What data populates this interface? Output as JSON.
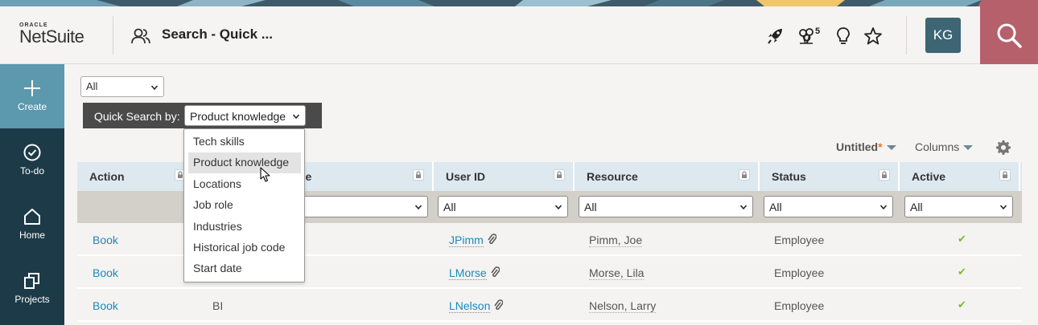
{
  "colors": {
    "sidebar": "#1d3a48",
    "sidebar_active": "#5c98ae",
    "search_button": "#b5606b",
    "link": "#1f87bd",
    "check": "#7dba27",
    "avatar": "#3d6573"
  },
  "header": {
    "logo_oracle": "ORACLE",
    "logo_name": "NetSuite",
    "page_icon": "people-icon",
    "title": "Search - Quick ...",
    "icons": [
      "rocket-icon",
      "balloons-icon",
      "lightbulb-icon",
      "star-icon"
    ],
    "notification_count": "5",
    "avatar_initials": "KG",
    "search_icon": "search-icon"
  },
  "sidebar": {
    "items": [
      {
        "label": "Create",
        "icon": "plus-icon"
      },
      {
        "label": "To-do",
        "icon": "check-circle-icon"
      },
      {
        "label": "Home",
        "icon": "home-icon"
      },
      {
        "label": "Projects",
        "icon": "projects-icon"
      }
    ]
  },
  "filters": {
    "top_select": "All"
  },
  "quick_search": {
    "label": "Quick Search by:",
    "selected": "Product knowledge"
  },
  "dropdown": {
    "options": [
      "Tech skills",
      "Product knowledge",
      "Locations",
      "Job role",
      "Industries",
      "Historical job code",
      "Start date"
    ],
    "highlighted_index": 1
  },
  "view": {
    "name": "Untitled",
    "modified_marker": "*",
    "columns_label": "Columns"
  },
  "table": {
    "headers": [
      "Action",
      "ge",
      "User ID",
      "Resource",
      "Status",
      "Active"
    ],
    "filter_values": [
      "All",
      "All",
      "All",
      "All"
    ],
    "rows": [
      {
        "action": "Book",
        "col2": "",
        "user_id": "JPimm",
        "resource": "Pimm, Joe",
        "status": "Employee",
        "active": "✔"
      },
      {
        "action": "Book",
        "col2": "",
        "user_id": "LMorse",
        "resource": "Morse, Lila",
        "status": "Employee",
        "active": "✔"
      },
      {
        "action": "Book",
        "col2": "BI",
        "user_id": "LNelson",
        "resource": "Nelson, Larry",
        "status": "Employee",
        "active": "✔"
      }
    ]
  }
}
